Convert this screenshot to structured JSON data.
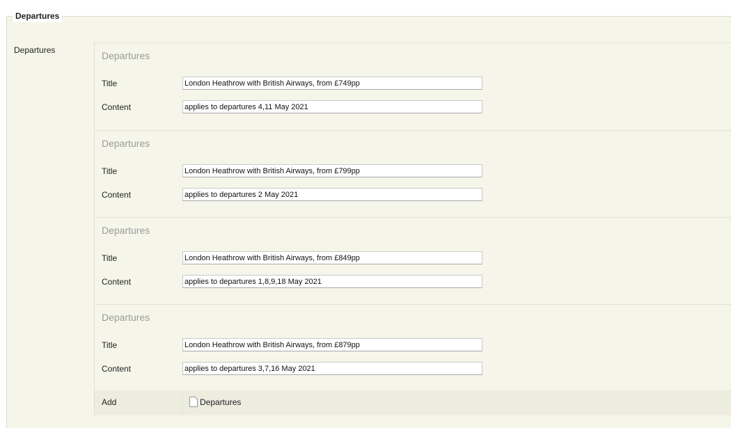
{
  "fieldset": {
    "legend": "Departures",
    "field_label": "Departures"
  },
  "groups": [
    {
      "heading": "Departures",
      "title_label": "Title",
      "title_value": "London Heathrow with British Airways, from £749pp",
      "content_label": "Content",
      "content_value": "applies to departures 4,11 May 2021"
    },
    {
      "heading": "Departures",
      "title_label": "Title",
      "title_value": "London Heathrow with British Airways, from £799pp",
      "content_label": "Content",
      "content_value": "applies to departures 2 May 2021"
    },
    {
      "heading": "Departures",
      "title_label": "Title",
      "title_value": "London Heathrow with British Airways, from £849pp",
      "content_label": "Content",
      "content_value": "applies to departures 1,8,9,18 May 2021"
    },
    {
      "heading": "Departures",
      "title_label": "Title",
      "title_value": "London Heathrow with British Airways, from £879pp",
      "content_label": "Content",
      "content_value": "applies to departures 3,7,16 May 2021"
    }
  ],
  "add_row": {
    "label": "Add",
    "button_label": "Departures",
    "icon": "document-icon"
  },
  "colors": {
    "panel_bg": "#f5f6e9",
    "add_row_bg": "#ececdf",
    "heading_text": "#9a9a9a"
  }
}
